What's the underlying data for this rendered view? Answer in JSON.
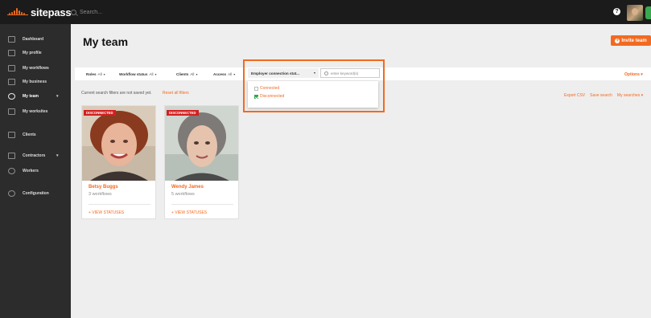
{
  "app": {
    "logo_text": "sitepass"
  },
  "topbar": {
    "search_placeholder": "Search...",
    "help_label": "?"
  },
  "sidebar": {
    "items": [
      {
        "label": "Dashboard"
      },
      {
        "label": "My profile"
      },
      {
        "label": "My workflows"
      },
      {
        "label": "My business"
      },
      {
        "label": "My team"
      },
      {
        "label": "My worksites"
      },
      {
        "label": "Clients"
      },
      {
        "label": "Contractors"
      },
      {
        "label": "Workers"
      },
      {
        "label": "Configuration"
      }
    ]
  },
  "page": {
    "title": "My team",
    "invite_label": "Invite team"
  },
  "filters": {
    "roles": {
      "label": "Roles",
      "value": "All"
    },
    "workflow": {
      "label": "Workflow status",
      "value": "All"
    },
    "clients": {
      "label": "Clients",
      "value": "All"
    },
    "access": {
      "label": "Access",
      "value": "All"
    },
    "connection": {
      "label": "Employer connection stat..."
    },
    "keyword_placeholder": "enter keyword(s)",
    "options_label": "Options"
  },
  "dropdown": {
    "options": [
      {
        "label": "Connected",
        "checked": false
      },
      {
        "label": "Disconnected",
        "checked": true
      }
    ]
  },
  "notice": {
    "text": "Current search filters are not saved yet.",
    "reset_label": "Reset all filters"
  },
  "actions": {
    "export": "Export CSV",
    "save": "Save search",
    "my_searches": "My searches"
  },
  "members": [
    {
      "badge": "DISCONNECTED",
      "name": "Betsy Buggs",
      "workflows": "3 workflows",
      "link": "+ VIEW STATUSES"
    },
    {
      "badge": "DISCONNECTED",
      "name": "Wendy James",
      "workflows": "5 workflows",
      "link": "+ VIEW STATUSES"
    }
  ],
  "colors": {
    "accent": "#f26a21",
    "badge": "#d11f1f",
    "sidebar": "#2c2c2c",
    "topbar": "#1b1b1b",
    "check": "#2fa84f"
  }
}
